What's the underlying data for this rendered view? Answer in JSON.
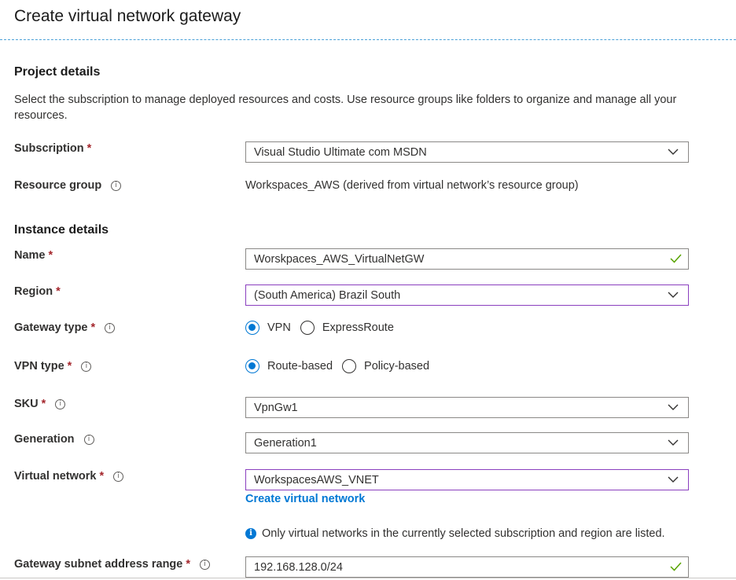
{
  "header": {
    "title": "Create virtual network gateway"
  },
  "project": {
    "heading": "Project details",
    "description": "Select the subscription to manage deployed resources and costs. Use resource groups like folders to organize and manage all your resources."
  },
  "subscription": {
    "label": "Subscription",
    "value": "Visual Studio Ultimate com MSDN"
  },
  "resource_group": {
    "label": "Resource group",
    "value": "Workspaces_AWS (derived from virtual network’s resource group)"
  },
  "instance": {
    "heading": "Instance details"
  },
  "name": {
    "label": "Name",
    "value": "Worskpaces_AWS_VirtualNetGW"
  },
  "region": {
    "label": "Region",
    "value": "(South America) Brazil South"
  },
  "gateway_type": {
    "label": "Gateway type",
    "options": [
      "VPN",
      "ExpressRoute"
    ],
    "selected": "VPN"
  },
  "vpn_type": {
    "label": "VPN type",
    "options": [
      "Route-based",
      "Policy-based"
    ],
    "selected": "Route-based"
  },
  "sku": {
    "label": "SKU",
    "value": "VpnGw1"
  },
  "generation": {
    "label": "Generation",
    "value": "Generation1"
  },
  "virtual_network": {
    "label": "Virtual network",
    "value": "WorkspacesAWS_VNET",
    "create_link": "Create virtual network",
    "note": "Only virtual networks in the currently selected subscription and region are listed."
  },
  "gateway_subnet": {
    "label": "Gateway subnet address range",
    "value": "192.168.128.0/24"
  },
  "icons": {
    "dropdown": "chevron-down-icon",
    "valid": "checkmark-icon",
    "info": "info-icon",
    "note": "info-filled-icon"
  },
  "colors": {
    "accent": "#0078d4",
    "required": "#a4262c",
    "valid": "#57a300",
    "focus_border": "#8a3fbf"
  }
}
